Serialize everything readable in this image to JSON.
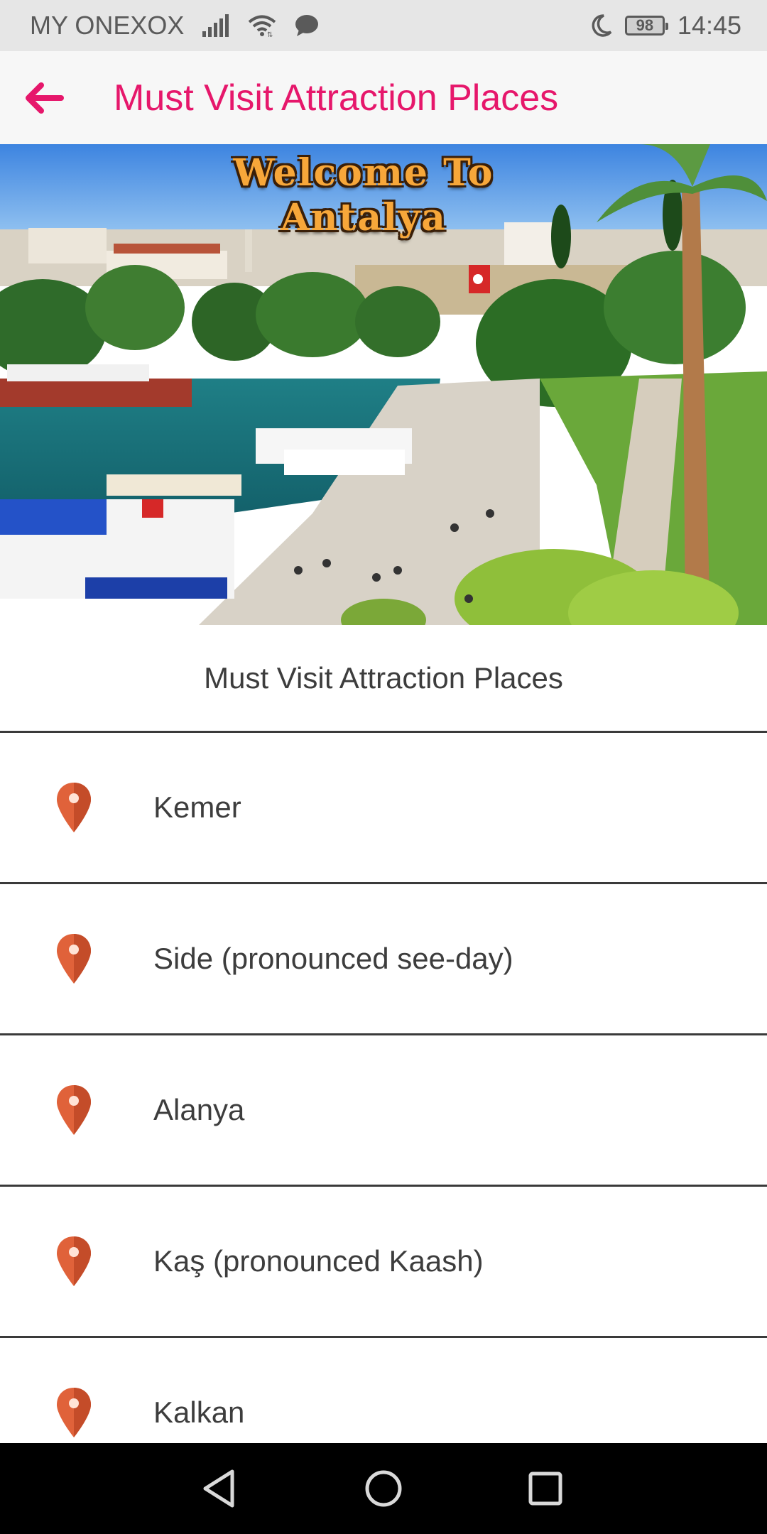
{
  "status_bar": {
    "carrier": "MY ONEXOX",
    "battery": "98",
    "time": "14:45"
  },
  "app_bar": {
    "title": "Must Visit Attraction Places"
  },
  "hero": {
    "line1": "Welcome To",
    "line2": "Antalya"
  },
  "section": {
    "title": "Must Visit Attraction Places"
  },
  "places": [
    {
      "label": "Kemer"
    },
    {
      "label": "Side (pronounced see-day)"
    },
    {
      "label": "Alanya"
    },
    {
      "label": "Kaş (pronounced Kaash)"
    },
    {
      "label": "Kalkan"
    }
  ],
  "colors": {
    "accent": "#e6176b",
    "pin": "#e0623a",
    "text": "#3d3d3d"
  }
}
